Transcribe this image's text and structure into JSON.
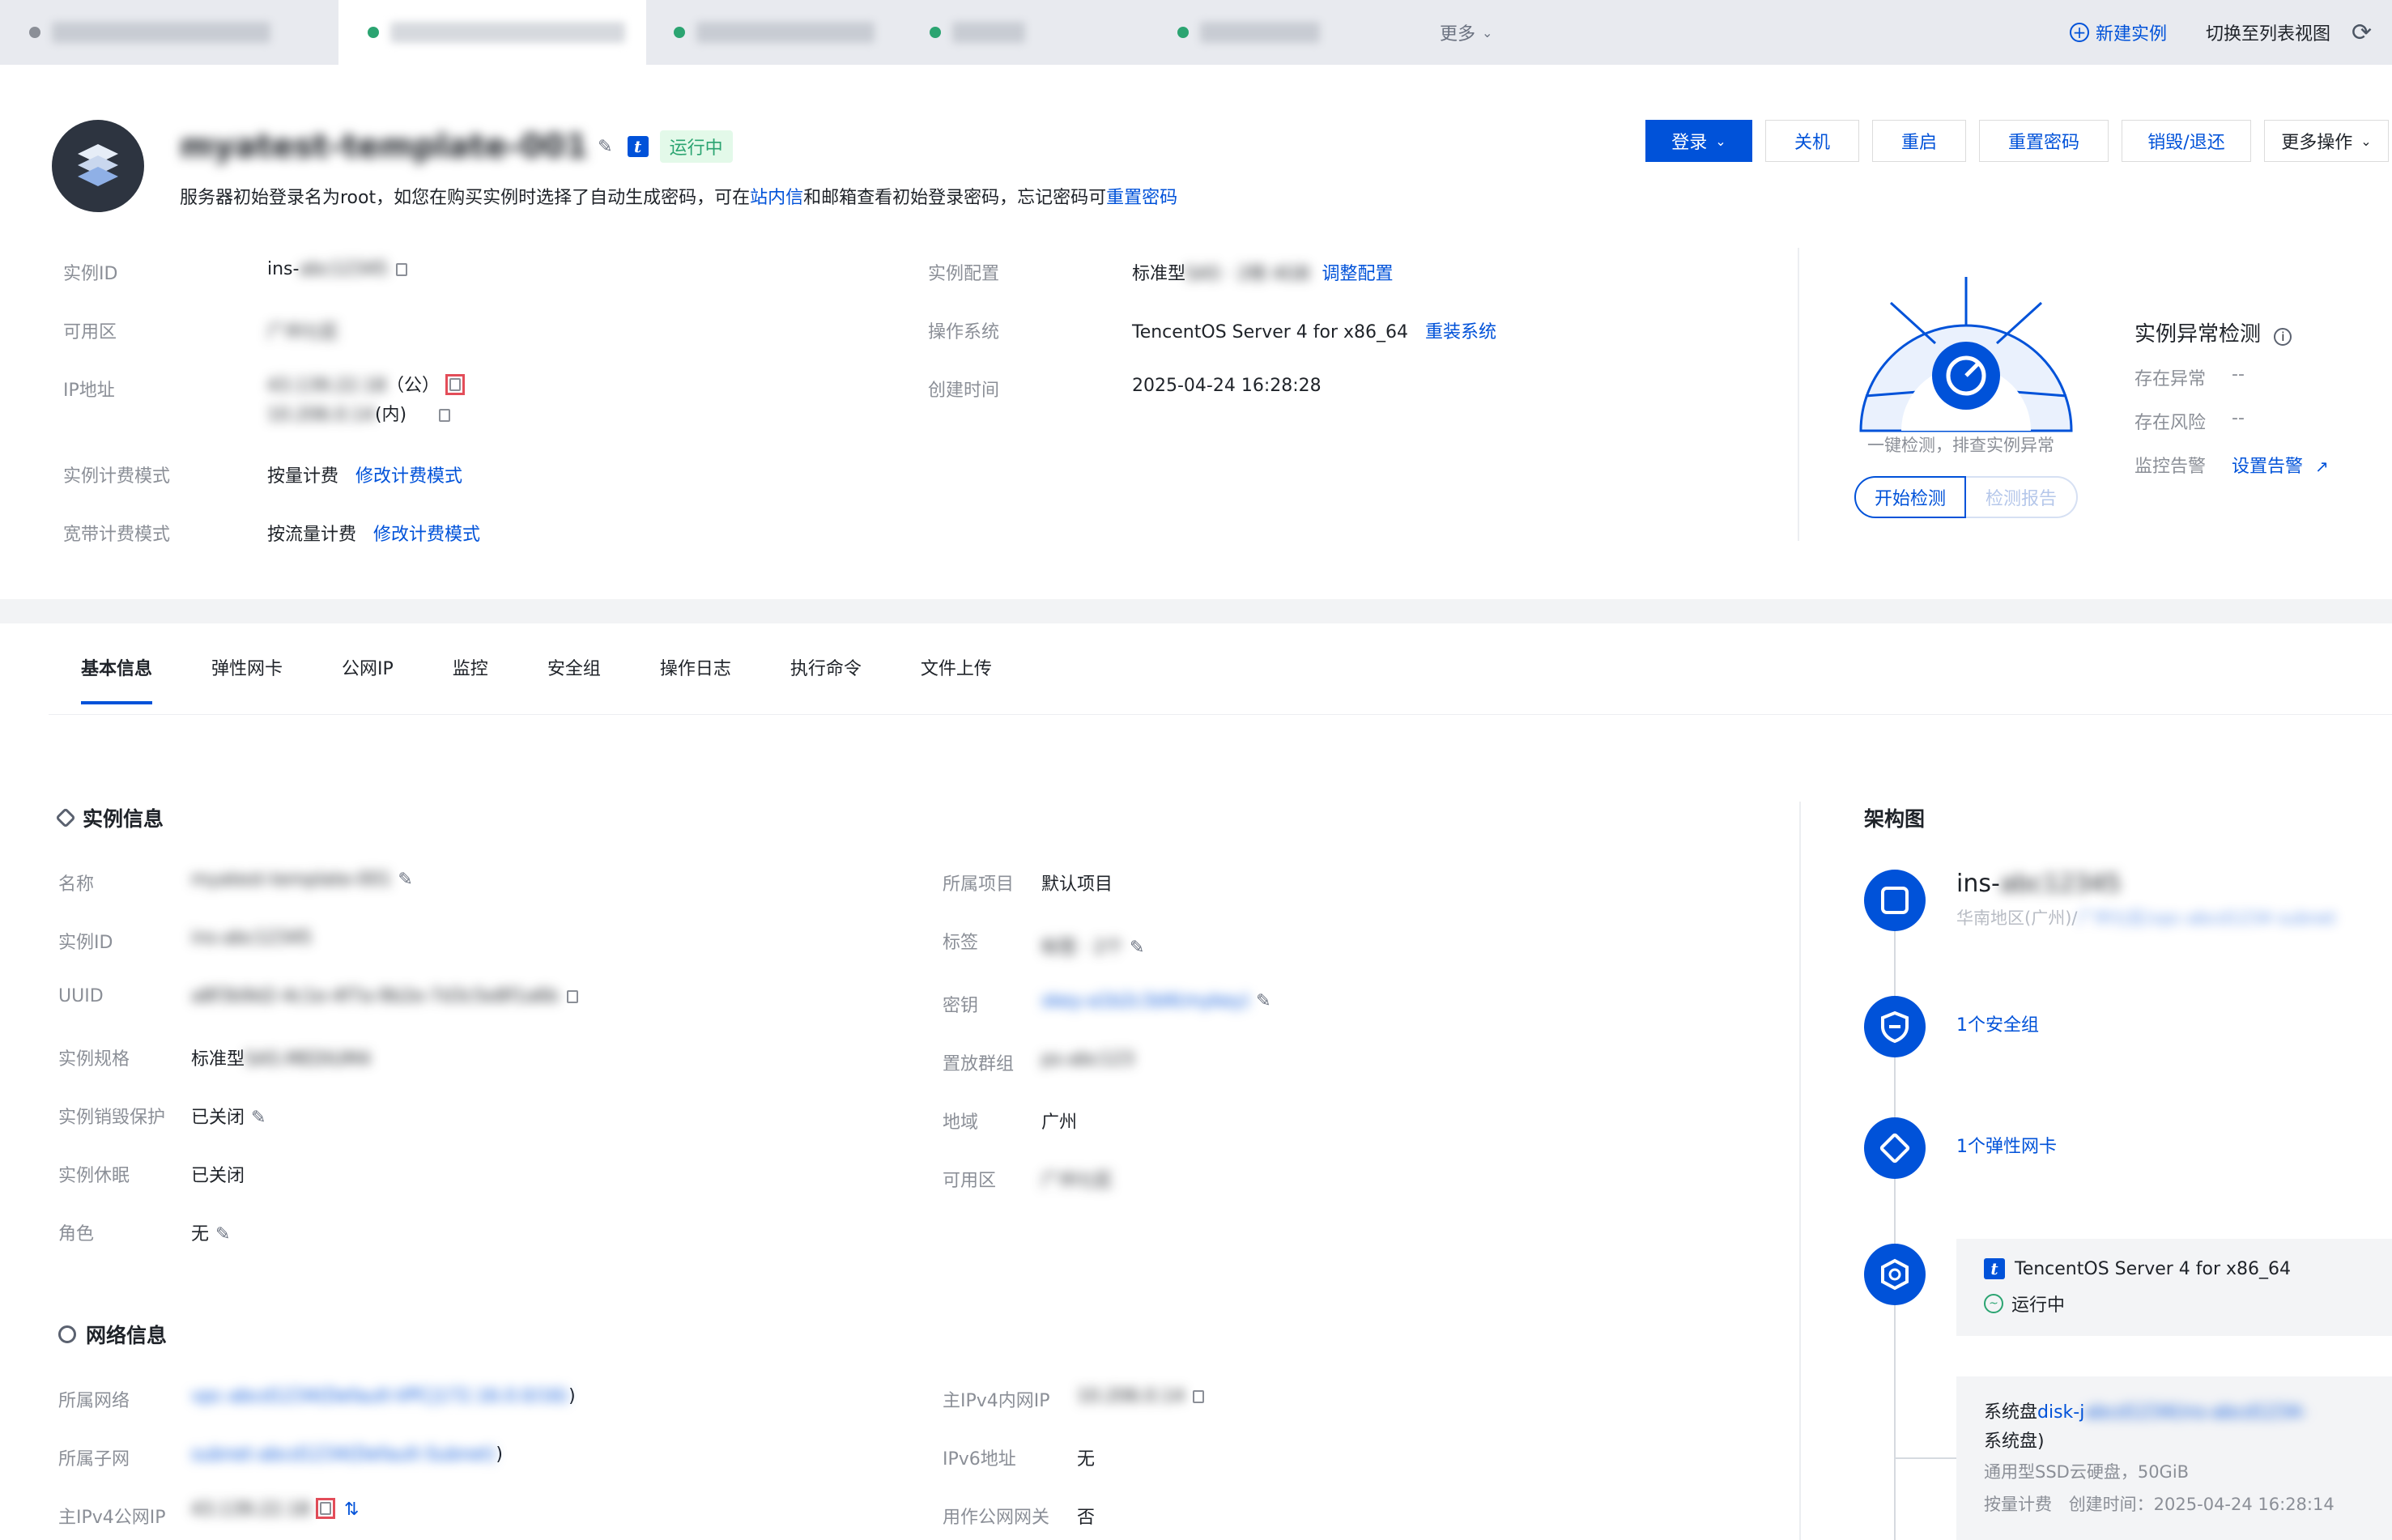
{
  "tabs": [
    {
      "label": "ins-ins-aq2bxqdm",
      "status": "stopped",
      "dot_color": "#8b8f97"
    },
    {
      "label": "myatest-template-001",
      "status": "running",
      "dot_color": "#2ba471",
      "active": true
    },
    {
      "label": "ins-cpu-instance",
      "status": "running",
      "dot_color": "#2ba471"
    },
    {
      "label": "instance-x",
      "status": "running",
      "dot_color": "#2ba471"
    },
    {
      "label": "app-server",
      "status": "running",
      "dot_color": "#2ba471"
    }
  ],
  "tab_more": "更多",
  "top_actions": {
    "new_instance": "新建实例",
    "switch_view": "切换至列表视图"
  },
  "header": {
    "instance_name": "myatest-template-001",
    "status": "运行中",
    "notice_prefix": "服务器初始登录名为root，如您在购买实例时选择了自动生成密码，可在",
    "notice_link1": "站内信",
    "notice_mid": "和邮箱查看初始登录密码，忘记密码可",
    "notice_link2": "重置密码"
  },
  "buttons": {
    "login": "登录",
    "shutdown": "关机",
    "restart": "重启",
    "reset_password": "重置密码",
    "destroy": "销毁/退还",
    "more": "更多操作"
  },
  "summary": {
    "instance_id_label": "实例ID",
    "instance_id_prefix": "ins-",
    "instance_id_blur": "abc12345",
    "zone_label": "可用区",
    "zone_value": "广州七区",
    "ip_label": "IP地址",
    "ip_public_blur": "43.139.22.18",
    "ip_public_suffix": "（公）",
    "ip_private_blur": "10.206.0.14",
    "ip_private_suffix": "(内)",
    "billing_label": "实例计费模式",
    "billing_value": "按量计费",
    "billing_link": "修改计费模式",
    "bw_label": "宽带计费模式",
    "bw_value": "按流量计费",
    "bw_link": "修改计费模式",
    "config_label": "实例配置",
    "config_value": "标准型",
    "config_blur": "SA5 · 2核 4GB",
    "config_link": "调整配置",
    "os_label": "操作系统",
    "os_value": "TencentOS Server 4 for x86_64",
    "os_link": "重装系统",
    "created_label": "创建时间",
    "created_value": "2025-04-24 16:28:28"
  },
  "detection": {
    "title": "实例异常检测",
    "caption": "一键检测，排查实例异常",
    "start_btn": "开始检测",
    "report_btn": "检测报告",
    "abnormal_label": "存在异常",
    "abnormal_value": "--",
    "risk_label": "存在风险",
    "risk_value": "--",
    "alarm_label": "监控告警",
    "alarm_link": "设置告警"
  },
  "detail_tabs": [
    "基本信息",
    "弹性网卡",
    "公网IP",
    "监控",
    "安全组",
    "操作日志",
    "执行命令",
    "文件上传"
  ],
  "instance_info": {
    "title": "实例信息",
    "rows_left": [
      {
        "label": "名称",
        "value": "myatest-template-001",
        "blur": true,
        "icon": "edit"
      },
      {
        "label": "实例ID",
        "value": "ins-abc12345",
        "blur": true
      },
      {
        "label": "UUID",
        "value": "a8f3b9d2-4c1e-4f7a-9b2e-7d3c5e8f1a6b",
        "blur": true,
        "icon": "copy"
      },
      {
        "label": "实例规格",
        "value": "标准型",
        "blur_suffix": "SA5.MEDIUM4"
      },
      {
        "label": "实例销毁保护",
        "value": "已关闭",
        "icon": "edit"
      },
      {
        "label": "实例休眠",
        "value": "已关闭"
      },
      {
        "label": "角色",
        "value": "无",
        "icon": "edit"
      }
    ],
    "rows_right": [
      {
        "label": "所属项目",
        "value": "默认项目"
      },
      {
        "label": "标签",
        "value": "标签 · 2个",
        "blur": true,
        "icon": "edit"
      },
      {
        "label": "密钥",
        "value": "skey-a1b2c3d4(mykey)",
        "blur": true,
        "link": true,
        "icon": "edit"
      },
      {
        "label": "置放群组",
        "value": "ps-abc123",
        "blur": true,
        "link": true
      },
      {
        "label": "地域",
        "value": "广州"
      },
      {
        "label": "可用区",
        "value": "广州七区",
        "blur": true
      }
    ]
  },
  "network_info": {
    "title": "网络信息",
    "rows_left": [
      {
        "label": "所属网络",
        "value": "vpc-abcd1234(Default-VPC|172.16.0.0/16)",
        "suffix": ")"
      },
      {
        "label": "所属子网",
        "value": "subnet-abcd1234(Default-Subnet)",
        "suffix": ")"
      },
      {
        "label": "主IPv4公网IP",
        "value": "43.139.22.18"
      }
    ],
    "rows_right": [
      {
        "label": "主IPv4内网IP",
        "value": "10.206.0.14"
      },
      {
        "label": "IPv6地址",
        "value": "无"
      },
      {
        "label": "用作公网网关",
        "value": "否"
      }
    ]
  },
  "architecture": {
    "title": "架构图",
    "instance_prefix": "ins-",
    "instance_blur": "abc12345",
    "region_prefix": "华南地区(广州)/",
    "region_blur": "广州七区/vpc-abcd1234 subnet",
    "security_group": "1个安全组",
    "eni": "1个弹性网卡",
    "os_name": "TencentOS Server 4 for x86_64",
    "os_status": "运行中",
    "disk_prefix": "系统盘",
    "disk_link": "disk-j",
    "disk_blur": "abcd1234(ins-abcd1234-",
    "disk_suffix": "系统盘)",
    "disk_type": "通用型SSD云硬盘，50GiB",
    "disk_billing": "按量计费",
    "disk_created": "创建时间：2025-04-24 16:28:14"
  },
  "colors": {
    "brand": "#0052d9",
    "success": "#2ba471",
    "danger": "#e34d59"
  }
}
